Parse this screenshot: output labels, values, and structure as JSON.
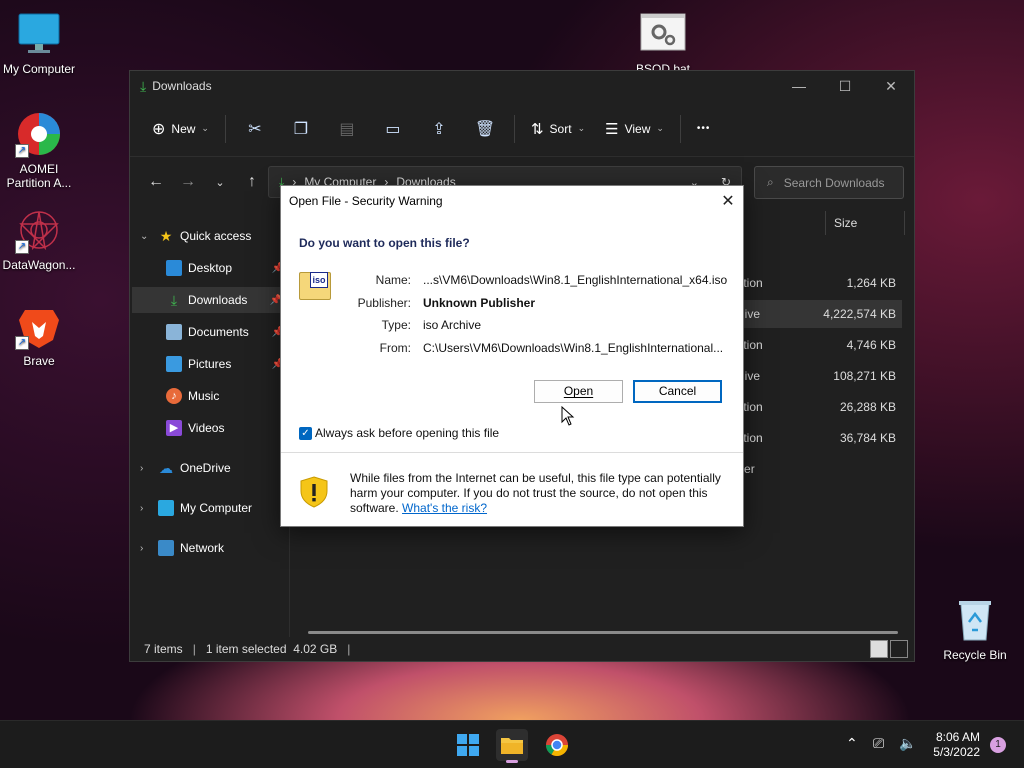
{
  "desktop": {
    "icons": [
      {
        "label": "My Computer"
      },
      {
        "label": "AOMEI\nPartition A..."
      },
      {
        "label": "DataWagon..."
      },
      {
        "label": "Brave"
      },
      {
        "label": "BSOD.bat"
      },
      {
        "label": "Recycle Bin"
      }
    ]
  },
  "explorer": {
    "title": "Downloads",
    "toolbar": {
      "new_label": "New",
      "sort_label": "Sort",
      "view_label": "View",
      "more_label": "•••"
    },
    "address": {
      "crumb1": "My Computer",
      "crumb2": "Downloads",
      "search_placeholder": "Search Downloads"
    },
    "sidebar": {
      "quick_access": "Quick access",
      "desktop": "Desktop",
      "downloads": "Downloads",
      "documents": "Documents",
      "pictures": "Pictures",
      "music": "Music",
      "videos": "Videos",
      "onedrive": "OneDrive",
      "my_computer": "My Computer",
      "network": "Network"
    },
    "columns": {
      "size": "Size"
    },
    "files": [
      {
        "type": "ication",
        "size": "1,264 KB"
      },
      {
        "type": "rchive",
        "size": "4,222,574 KB"
      },
      {
        "type": "ication",
        "size": "4,746 KB"
      },
      {
        "type": "rchive",
        "size": "108,271 KB"
      },
      {
        "type": "ication",
        "size": "26,288 KB"
      },
      {
        "type": "ication",
        "size": "36,784 KB"
      },
      {
        "type": "older",
        "size": ""
      }
    ],
    "status": {
      "items": "7 items",
      "selected": "1 item selected  4.02 GB"
    }
  },
  "dialog": {
    "title": "Open File - Security Warning",
    "question": "Do you want to open this file?",
    "file_badge": "iso",
    "labels": {
      "name": "Name:",
      "publisher": "Publisher:",
      "type": "Type:",
      "from": "From:"
    },
    "values": {
      "name": "...s\\VM6\\Downloads\\Win8.1_EnglishInternational_x64.iso",
      "publisher": "Unknown Publisher",
      "type": "iso Archive",
      "from": "C:\\Users\\VM6\\Downloads\\Win8.1_EnglishInternational..."
    },
    "open_label": "Open",
    "cancel_label": "Cancel",
    "checkbox_label": "Always ask before opening this file",
    "warning_text": "While files from the Internet can be useful, this file type can potentially harm your computer. If you do not trust the source, do not open this software.",
    "risk_link": "What's the risk?"
  },
  "taskbar": {
    "time": "8:06 AM",
    "date": "5/3/2022",
    "notification_count": "1"
  },
  "colors": {
    "accent": "#0067c0",
    "warning": "#f5c518"
  }
}
